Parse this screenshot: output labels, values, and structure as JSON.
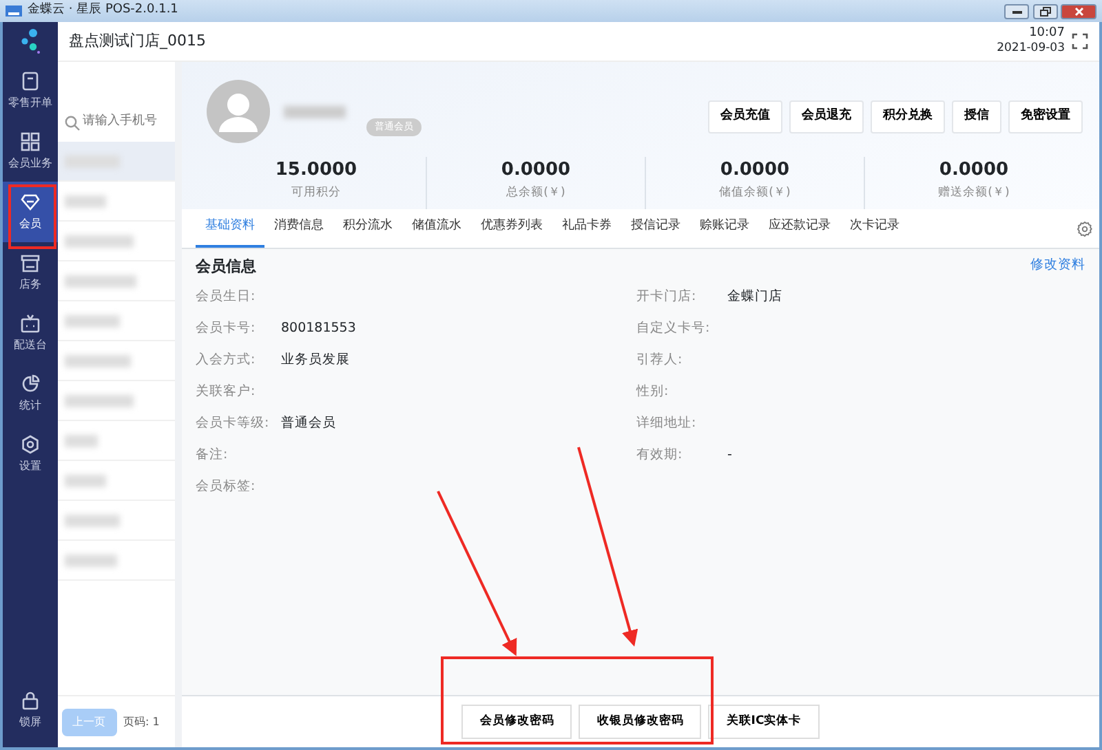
{
  "window": {
    "title": "金蝶云 · 星辰 POS-2.0.1.1"
  },
  "sidebar": {
    "items": [
      {
        "label": "零售开单",
        "kind": "receipt",
        "selected": false
      },
      {
        "label": "会员业务",
        "kind": "grid",
        "selected": false
      },
      {
        "label": "会员",
        "kind": "diamond",
        "selected": true
      },
      {
        "label": "店务",
        "kind": "store",
        "selected": false
      },
      {
        "label": "配送台",
        "kind": "delivery",
        "selected": false
      },
      {
        "label": "统计",
        "kind": "chart",
        "selected": false
      },
      {
        "label": "设置",
        "kind": "gear",
        "selected": false
      }
    ],
    "bottom_item": {
      "label": "锁屏",
      "kind": "lock"
    }
  },
  "header": {
    "store": "盘点测试门店_0015",
    "time": "10:07",
    "date": "2021-09-03"
  },
  "member_list": {
    "search": {
      "placeholder": "请输入手机号"
    },
    "pagination": {
      "prev": "上一页",
      "prev_disabled": true,
      "page": "页码: 1"
    }
  },
  "profile": {
    "badge": "普通会员",
    "actions": [
      "会员充值",
      "会员退充",
      "积分兑换",
      "授信",
      "免密设置"
    ]
  },
  "stats": [
    {
      "value": "15.0000",
      "label": "可用积分"
    },
    {
      "value": "0.0000",
      "label": "总余额(￥)"
    },
    {
      "value": "0.0000",
      "label": "储值余额(￥)"
    },
    {
      "value": "0.0000",
      "label": "赠送余额(￥)"
    }
  ],
  "tabs": [
    {
      "label": "基础资料",
      "selected": true
    },
    {
      "label": "消费信息",
      "selected": false
    },
    {
      "label": "积分流水",
      "selected": false
    },
    {
      "label": "储值流水",
      "selected": false
    },
    {
      "label": "优惠券列表",
      "selected": false
    },
    {
      "label": "礼品卡券",
      "selected": false
    },
    {
      "label": "授信记录",
      "selected": false
    },
    {
      "label": "赊账记录",
      "selected": false
    },
    {
      "label": "应还款记录",
      "selected": false
    },
    {
      "label": "次卡记录",
      "selected": false
    }
  ],
  "info": {
    "title": "会员信息",
    "edit_link": "修改资料",
    "left": [
      {
        "label": "会员生日:"
      },
      {
        "label": "会员卡号:",
        "value": "800181553"
      },
      {
        "label": "入会方式:",
        "value": "业务员发展"
      },
      {
        "label": "关联客户:"
      },
      {
        "label": "会员卡等级:",
        "value": "普通会员"
      },
      {
        "label": "备注:"
      },
      {
        "label": "会员标签:"
      }
    ],
    "right": [
      {
        "label": "开卡门店:",
        "value": "金蝶门店"
      },
      {
        "label": "自定义卡号:"
      },
      {
        "label": "引荐人:"
      },
      {
        "label": "性别:"
      },
      {
        "label": "详细地址:"
      },
      {
        "label": "有效期:",
        "value": "-"
      }
    ]
  },
  "footer_buttons": [
    "会员修改密码",
    "收银员修改密码",
    "关联IC实体卡"
  ]
}
